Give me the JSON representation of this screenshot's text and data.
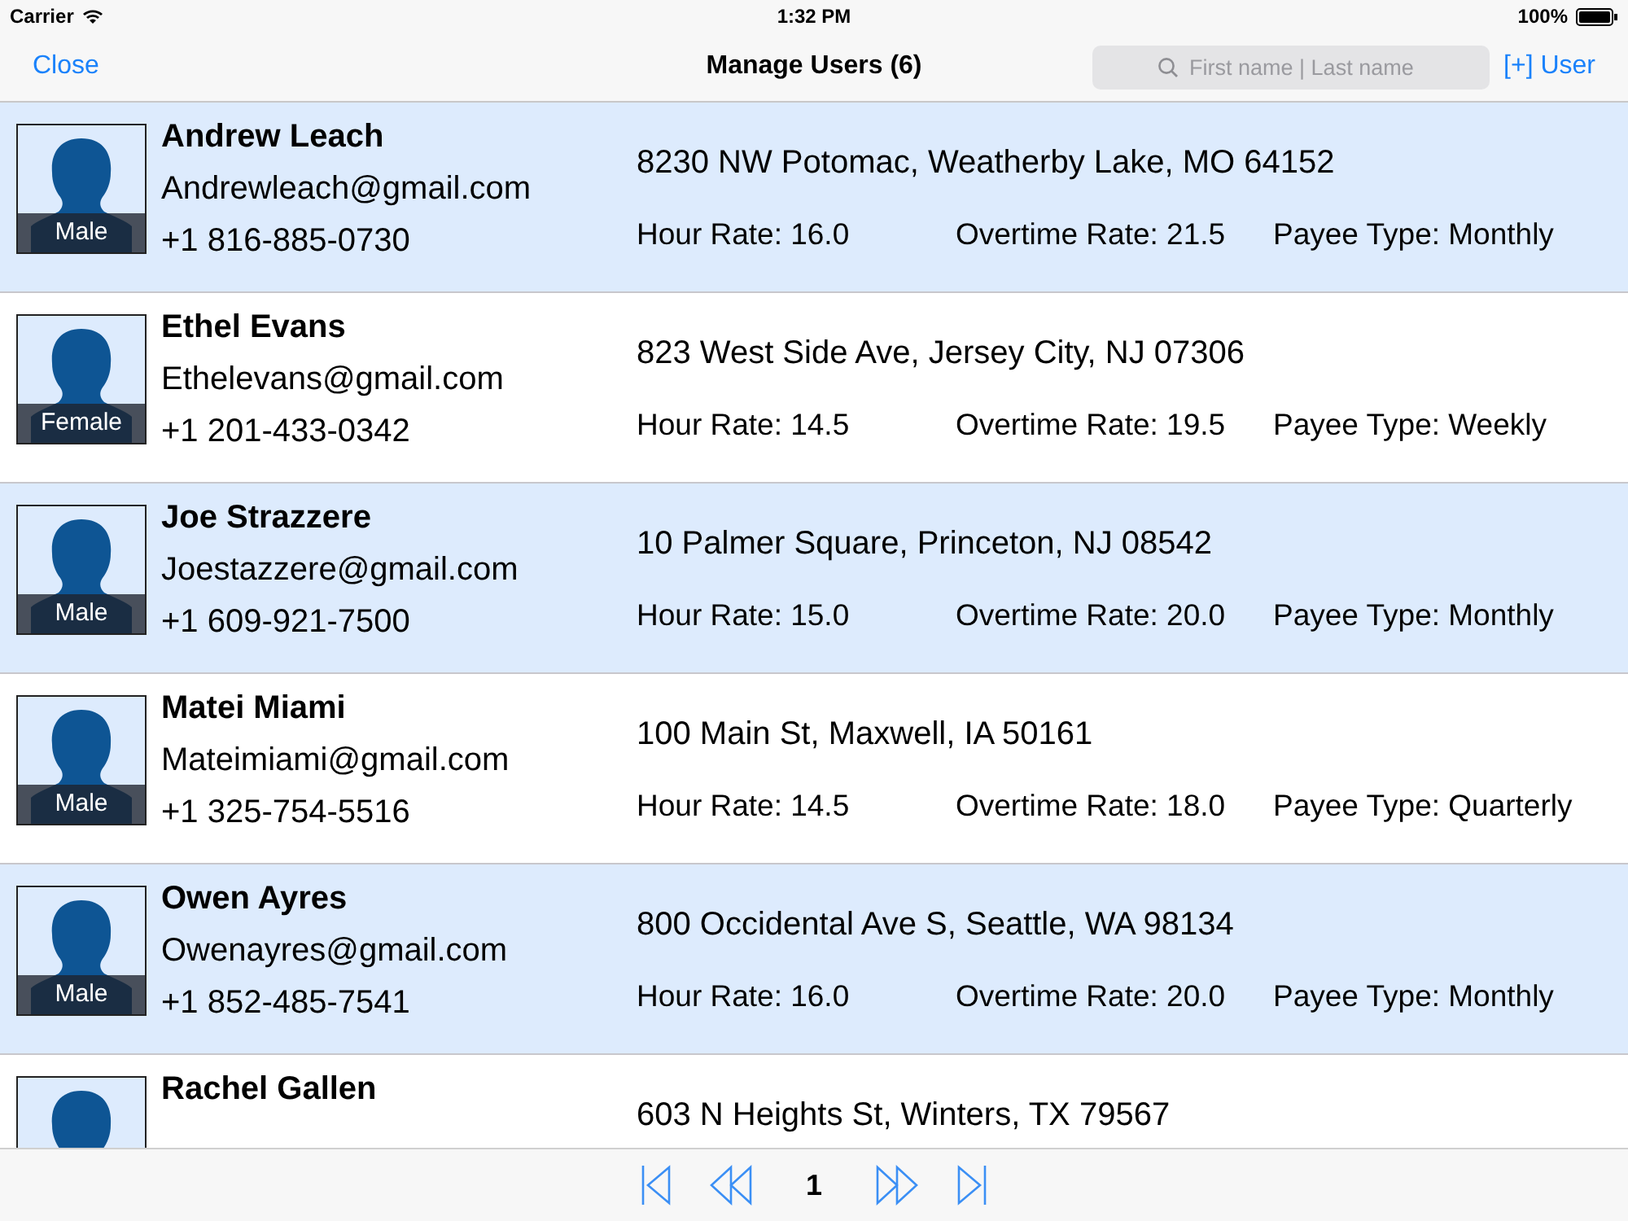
{
  "status_bar": {
    "carrier": "Carrier",
    "time": "1:32 PM",
    "battery": "100%"
  },
  "nav": {
    "close": "Close",
    "title": "Manage Users (6)",
    "search": {
      "placeholder": "First name | Last name"
    },
    "add": "[+] User"
  },
  "users": [
    {
      "name": "Andrew Leach",
      "email": "Andrewleach@gmail.com",
      "phone": "+1 816-885-0730",
      "gender": "Male",
      "address": "8230 NW Potomac, Weatherby Lake, MO 64152",
      "hour_rate": "Hour Rate: 16.0",
      "overtime_rate": "Overtime Rate: 21.5",
      "payee_type": "Payee Type: Monthly"
    },
    {
      "name": "Ethel Evans",
      "email": "Ethelevans@gmail.com",
      "phone": "+1 201-433-0342",
      "gender": "Female",
      "address": "823 West Side Ave, Jersey City, NJ 07306",
      "hour_rate": "Hour Rate: 14.5",
      "overtime_rate": "Overtime Rate: 19.5",
      "payee_type": "Payee Type: Weekly"
    },
    {
      "name": "Joe Strazzere",
      "email": "Joestazzere@gmail.com",
      "phone": "+1 609-921-7500",
      "gender": "Male",
      "address": "10 Palmer Square, Princeton, NJ 08542",
      "hour_rate": "Hour Rate: 15.0",
      "overtime_rate": "Overtime Rate: 20.0",
      "payee_type": "Payee Type: Monthly"
    },
    {
      "name": "Matei Miami",
      "email": "Mateimiami@gmail.com",
      "phone": "+1 325-754-5516",
      "gender": "Male",
      "address": "100 Main St, Maxwell, IA 50161",
      "hour_rate": "Hour Rate: 14.5",
      "overtime_rate": "Overtime Rate: 18.0",
      "payee_type": "Payee Type: Quarterly"
    },
    {
      "name": "Owen Ayres",
      "email": "Owenayres@gmail.com",
      "phone": "+1 852-485-7541",
      "gender": "Male",
      "address": "800 Occidental Ave S, Seattle, WA 98134",
      "hour_rate": "Hour Rate: 16.0",
      "overtime_rate": "Overtime Rate: 20.0",
      "payee_type": "Payee Type: Monthly"
    },
    {
      "name": "Rachel Gallen",
      "address": "603 N Heights St, Winters, TX 79567"
    }
  ],
  "pager": {
    "page": "1"
  }
}
